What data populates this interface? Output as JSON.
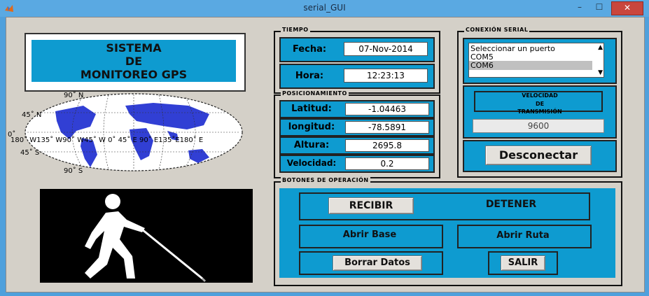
{
  "window": {
    "title": "serial_GUI",
    "min_label": "–",
    "max_label": "☐",
    "close_label": "✕"
  },
  "header": {
    "line1": "SISTEMA",
    "line2": "DE",
    "line3": "MONITOREO GPS"
  },
  "map": {
    "lat_labels": [
      "90˚ N",
      "45˚ N",
      "0˚",
      "45˚ S",
      "90˚ S"
    ],
    "lon_labels": "180˚ W135˚ W90˚ W45˚ W   0˚   45˚ E 90˚ E135˚E180˚ E"
  },
  "tiempo": {
    "title": "TIEMPO",
    "fecha_label": "Fecha:",
    "fecha_value": "07-Nov-2014",
    "hora_label": "Hora:",
    "hora_value": "12:23:13"
  },
  "posicionamiento": {
    "title": "POSICIONAMIENTO",
    "rows": [
      {
        "label": "Latitud:",
        "value": "-1.04463"
      },
      {
        "label": "longitud:",
        "value": "-78.5891"
      },
      {
        "label": "Altura:",
        "value": "2695.8"
      },
      {
        "label": "Velocidad:",
        "value": "0.2"
      }
    ]
  },
  "conexion": {
    "title": "CONEXIÓN SERIAL",
    "list_items": [
      "Seleccionar un puerto",
      "COM5",
      "COM6"
    ],
    "selected_item": "COM6",
    "velocidad_line1": "VELOCIDAD",
    "velocidad_line2": "DE",
    "velocidad_line3": "TRANSMISIÓN",
    "baud_value": "9600",
    "disconnect_label": "Desconectar"
  },
  "botones": {
    "title": "BOTONES DE OPERACIÓN",
    "recibir": "RECIBIR",
    "detener": "DETENER",
    "abrir_base": "Abrir Base",
    "abrir_ruta": "Abrir Ruta",
    "borrar_datos": "Borrar Datos",
    "salir": "SALIR"
  },
  "colors": {
    "panel_cyan": "#0e9bd0",
    "background_gray": "#d4d0c8",
    "close_red": "#c9463d"
  },
  "icons": {
    "app": "matlab-icon",
    "blind_person": "blind-pedestrian-icon"
  }
}
